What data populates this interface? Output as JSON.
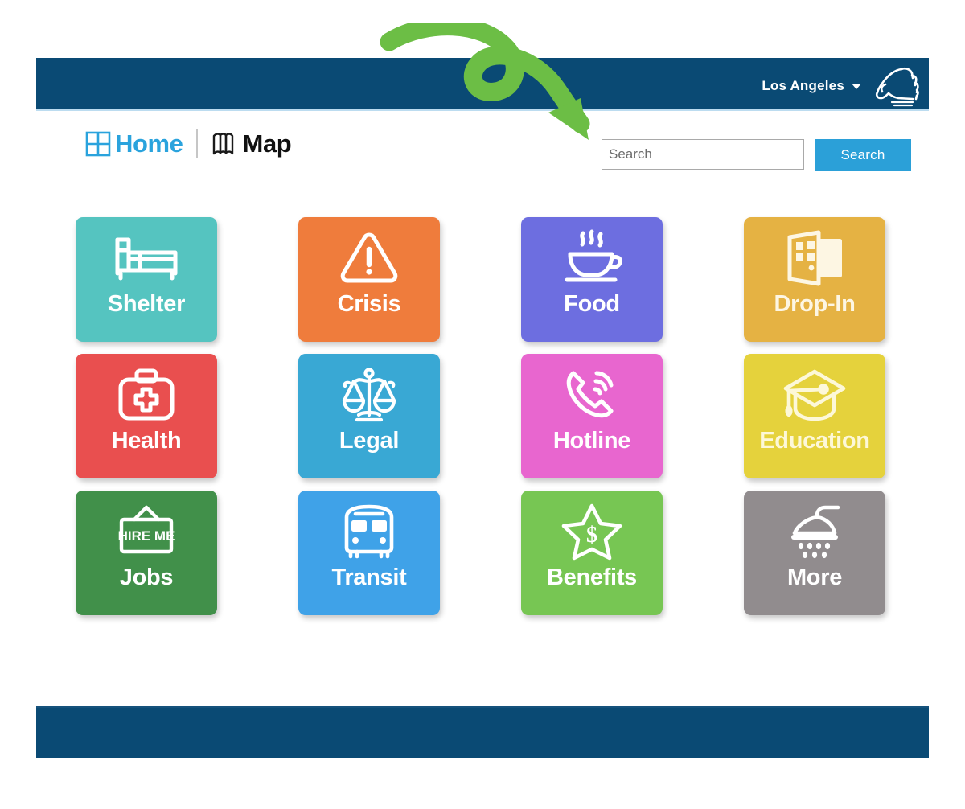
{
  "header": {
    "city_label": "Los Angeles",
    "city_caret_icon": "chevron-down-icon",
    "brand_logo_icon": "hand-fist-logo-icon",
    "bar_color": "#0a4a74"
  },
  "nav": {
    "home_label": "Home",
    "home_icon": "grid-four-squares-icon",
    "home_color": "#2aa3dd",
    "map_label": "Map",
    "map_icon": "folded-map-icon",
    "map_color": "#111111"
  },
  "search": {
    "placeholder": "Search",
    "value": "",
    "button_label": "Search",
    "button_color": "#2ba0d8"
  },
  "tiles": [
    {
      "label": "Shelter",
      "icon": "bed-icon",
      "color": "#55c4c0",
      "text_color": "#ffffff"
    },
    {
      "label": "Crisis",
      "icon": "warning-triangle-icon",
      "color": "#ef7c3c",
      "text_color": "#ffffff"
    },
    {
      "label": "Food",
      "icon": "coffee-cup-icon",
      "color": "#6d6ee0",
      "text_color": "#ffffff"
    },
    {
      "label": "Drop-In",
      "icon": "open-door-icon",
      "color": "#e5b243",
      "text_color": "#fdf6e3"
    },
    {
      "label": "Health",
      "icon": "medical-kit-icon",
      "color": "#e94f4f",
      "text_color": "#ffffff"
    },
    {
      "label": "Legal",
      "icon": "scales-of-justice-icon",
      "color": "#39a8d4",
      "text_color": "#ffffff"
    },
    {
      "label": "Hotline",
      "icon": "ringing-phone-icon",
      "color": "#e866cf",
      "text_color": "#ffffff"
    },
    {
      "label": "Education",
      "icon": "graduation-cap-icon",
      "color": "#e5d23c",
      "text_color": "#fdf8d8"
    },
    {
      "label": "Jobs",
      "icon": "hire-me-sign-icon",
      "color": "#41904a",
      "text_color": "#ffffff"
    },
    {
      "label": "Transit",
      "icon": "bus-icon",
      "color": "#3fa2e8",
      "text_color": "#ffffff"
    },
    {
      "label": "Benefits",
      "icon": "star-dollar-icon",
      "color": "#77c council",
      "text_color": "#ffffff"
    },
    {
      "label": "More",
      "icon": "shower-head-icon",
      "color": "#918c8e",
      "text_color": "#ffffff"
    }
  ],
  "jobs_sign_text": "HIRE ME",
  "benefits_symbol": "$",
  "annotation": {
    "type": "curved-arrow",
    "color": "#6cbe45",
    "points_to": "search-input"
  },
  "footer": {
    "color": "#0a4a74"
  }
}
